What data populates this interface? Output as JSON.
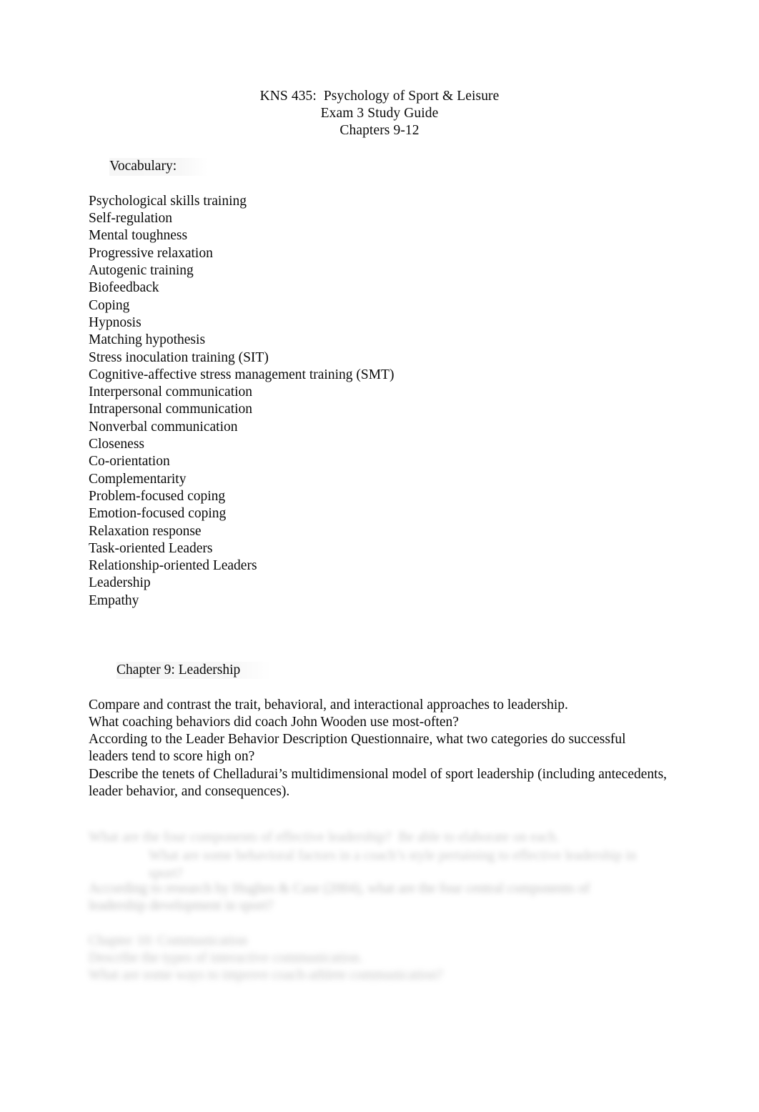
{
  "document": {
    "title_lines": [
      "KNS 435:  Psychology of Sport & Leisure",
      "Exam 3 Study Guide",
      "Chapters 9-12"
    ],
    "vocabulary": {
      "heading": "Vocabulary:",
      "terms": [
        "Psychological skills training",
        "Self-regulation",
        "Mental toughness",
        "Progressive relaxation",
        "Autogenic training",
        "Biofeedback",
        "Coping",
        "Hypnosis",
        "Matching hypothesis",
        "Stress inoculation training (SIT)",
        "Cognitive-affective stress management training (SMT)",
        "Interpersonal communication",
        "Intrapersonal communication",
        "Nonverbal communication",
        "Closeness",
        "Co-orientation",
        "Complementarity",
        "Problem-focused coping",
        "Emotion-focused coping",
        "Relaxation response",
        "Task-oriented Leaders",
        "Relationship-oriented Leaders",
        "Leadership",
        "Empathy"
      ]
    },
    "chapter9": {
      "heading": "Chapter 9: Leadership",
      "questions": [
        "Compare and contrast the trait, behavioral, and interactional approaches to leadership.",
        "What coaching behaviors did coach John Wooden use most-often?",
        "According to the Leader Behavior Description Questionnaire, what two categories do successful leaders tend to score high on?",
        "Describe the tenets of Chelladurai’s multidimensional model of sport leadership (including antecedents, leader behavior, and consequences)."
      ]
    },
    "degraded_region": {
      "note_legibility": "illegible",
      "lines": [
        "What are the four components of effective leadership?  Be able to elaborate on each.",
        "What are some behavioral factors in a coach’s style pertaining to effective leadership in",
        "sport?",
        "According to research by Hughes & Case (2004), what are the four central components of",
        "leadership development in sport?",
        "Chapter 10: Communication",
        "Describe the types of interactive communication.",
        "What are some ways to improve coach-athlete communication?"
      ]
    }
  }
}
